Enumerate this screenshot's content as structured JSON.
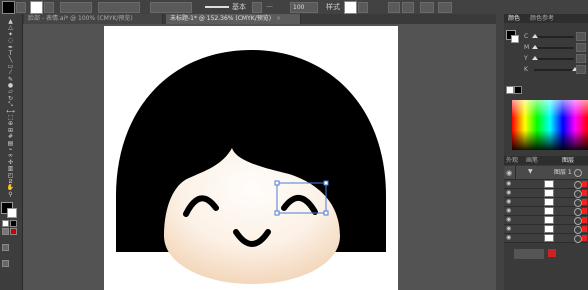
{
  "control_bar": {
    "fill_color": "#000000",
    "stroke_color": "#ffffff",
    "stroke_style_label": "基本",
    "opacity_label": "100",
    "style_label": "样式"
  },
  "tabs": [
    {
      "label": "脸部 - 表情.ai* @ 100% (CMYK/预览)",
      "active": false
    },
    {
      "label": "未标题-1* @ 152.36% (CMYK/预览)",
      "active": true
    }
  ],
  "tools": [
    "selection-tool",
    "direct-select-tool",
    "magic-wand-tool",
    "lasso-tool",
    "pen-tool",
    "type-tool",
    "line-tool",
    "rectangle-tool",
    "paintbrush-tool",
    "pencil-tool",
    "blob-brush-tool",
    "eraser-tool",
    "rotate-tool",
    "scale-tool",
    "width-tool",
    "free-transform-tool",
    "shape-builder-tool",
    "perspective-tool",
    "mesh-tool",
    "gradient-tool",
    "eyedropper-tool",
    "blend-tool",
    "symbol-sprayer-tool",
    "graph-tool",
    "artboard-tool",
    "slice-tool",
    "hand-tool",
    "zoom-tool"
  ],
  "color_panel": {
    "tabs": [
      "颜色",
      "颜色参考"
    ],
    "sliders": [
      {
        "label": "C",
        "value": 0
      },
      {
        "label": "M",
        "value": 0
      },
      {
        "label": "Y",
        "value": 0
      },
      {
        "label": "K",
        "value": 100
      }
    ]
  },
  "layers_panel": {
    "tabs": [
      "外观",
      "画笔",
      "图层"
    ],
    "top_layer": "图层 1",
    "rows": [
      {
        "thumb": "hair"
      },
      {
        "thumb": "eye"
      },
      {
        "thumb": "eye"
      },
      {
        "thumb": "mouth"
      },
      {
        "thumb": "mouth"
      },
      {
        "thumb": "face"
      },
      {
        "thumb": "face"
      }
    ]
  },
  "colors": {
    "hair": "#000000",
    "skin_light": "#fefaf6",
    "skin_edge": "#f7e2cc",
    "selection": "#4a7ed8",
    "layer_target": "#e22222"
  }
}
